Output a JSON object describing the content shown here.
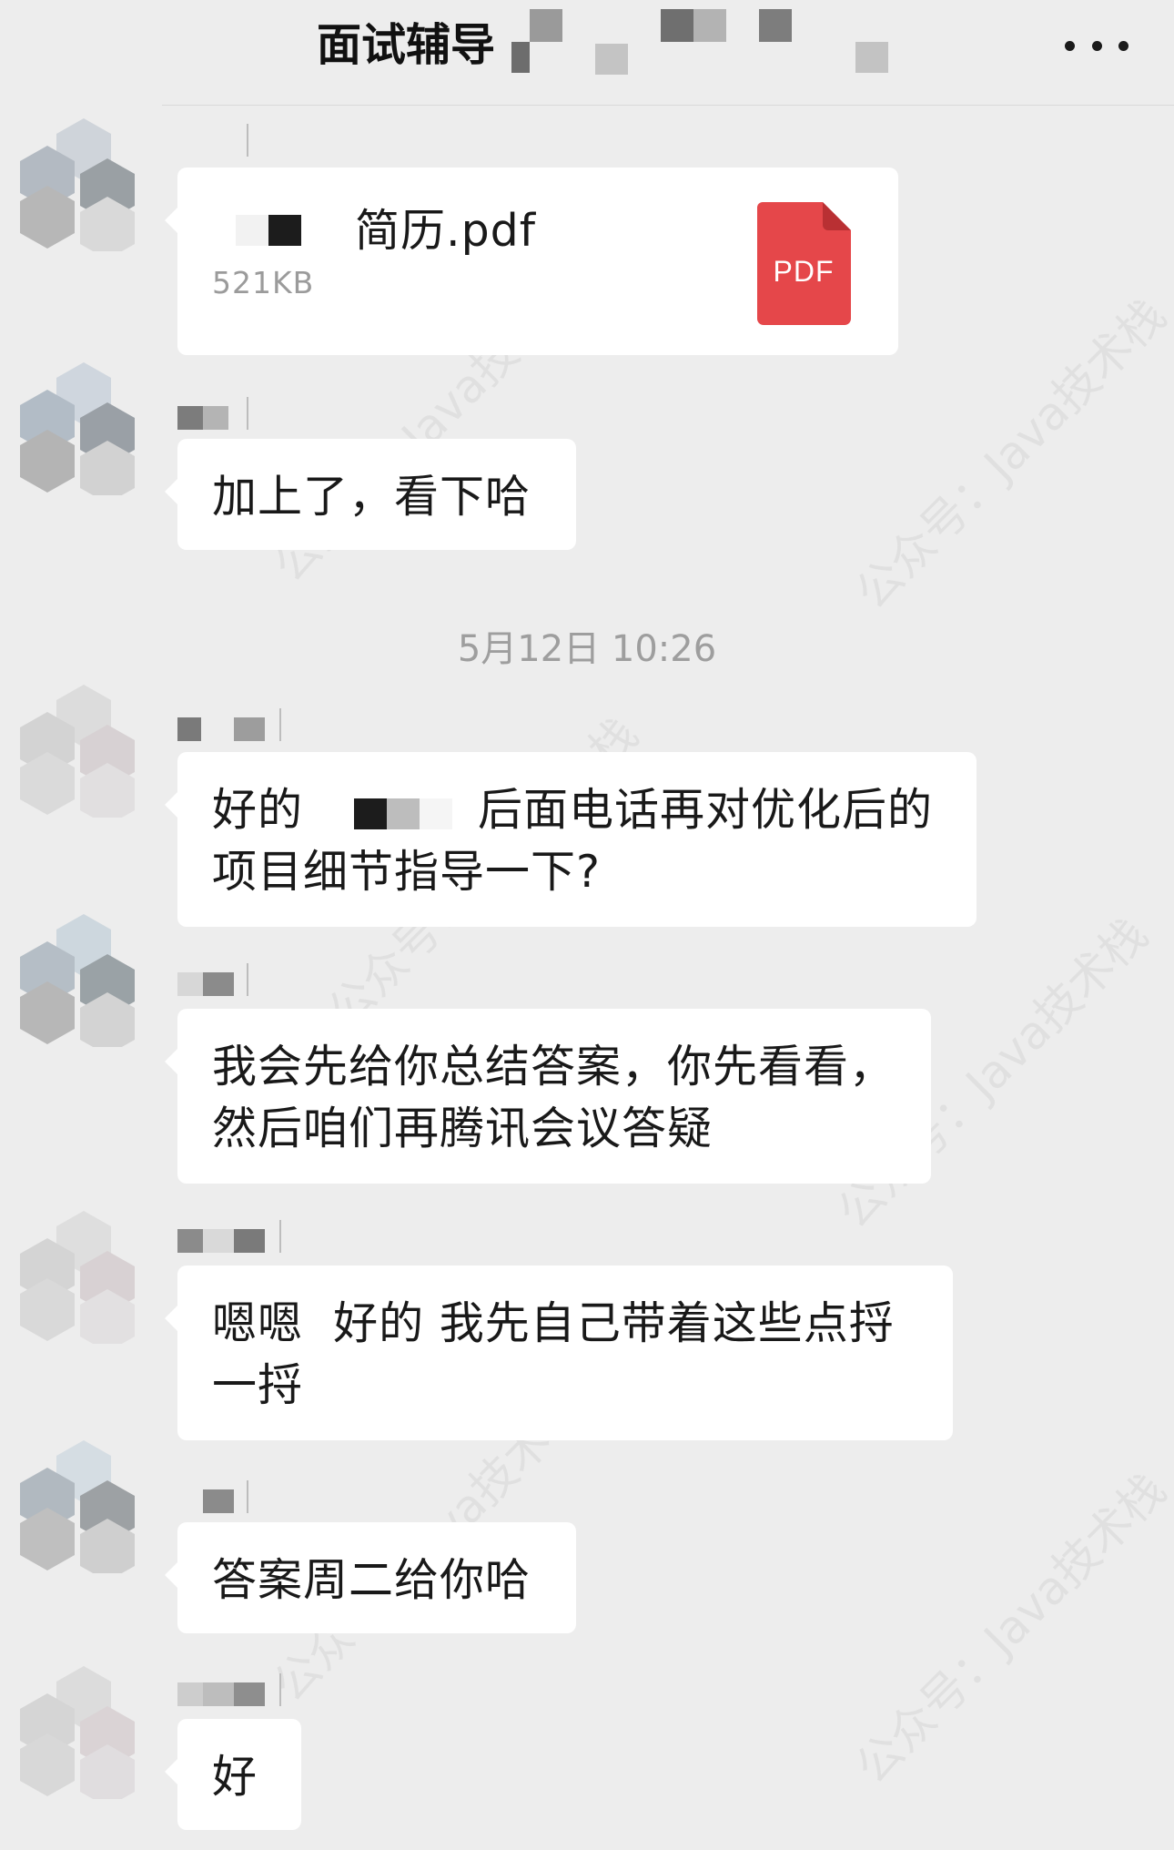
{
  "header": {
    "title": "面试辅导",
    "more_icon": "more-dots-icon"
  },
  "messages": [
    {
      "type": "file",
      "file_name": "简历.pdf",
      "file_size": "521KB",
      "file_icon_label": "PDF",
      "file_icon_color": "#e5474a"
    },
    {
      "type": "text",
      "text": "加上了，看下哈"
    },
    {
      "type": "text",
      "text_before": "好的",
      "text_after": "后面电话再对优化后的项目细节指导一下?"
    },
    {
      "type": "text",
      "text": "我会先给你总结答案，你先看看，然后咱们再腾讯会议答疑"
    },
    {
      "type": "text",
      "text": "嗯嗯  好的 我先自己带着这些点捋一捋"
    },
    {
      "type": "text",
      "text": "答案周二给你哈"
    },
    {
      "type": "text",
      "text": "好"
    }
  ],
  "timestamp": "5月12日 10:26",
  "watermark": "公众号：Java技术栈",
  "colors": {
    "background": "#ededed",
    "bubble": "#ffffff",
    "pdf_icon": "#e5474a"
  }
}
